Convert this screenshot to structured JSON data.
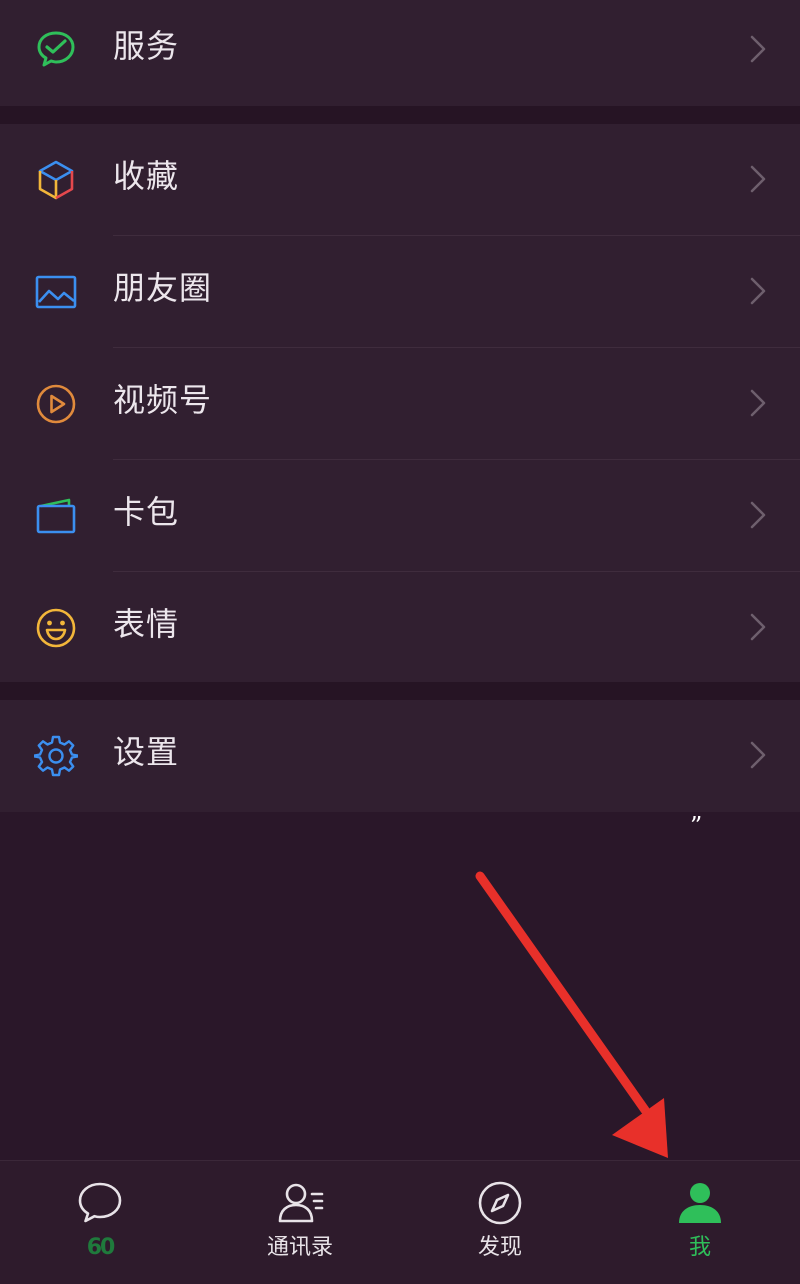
{
  "menu": {
    "services": {
      "label": "服务",
      "icon": "services-check-icon"
    },
    "favorites": {
      "label": "收藏",
      "icon": "favorites-cube-icon"
    },
    "moments": {
      "label": "朋友圈",
      "icon": "moments-image-icon"
    },
    "channels": {
      "label": "视频号",
      "icon": "channels-play-icon"
    },
    "cards": {
      "label": "卡包",
      "icon": "wallet-card-icon"
    },
    "stickers": {
      "label": "表情",
      "icon": "smiley-icon"
    },
    "settings": {
      "label": "设置",
      "icon": "gear-icon"
    }
  },
  "stray_mark": "”",
  "tabbar": {
    "tabs": [
      {
        "label": "60",
        "icon": "chat-bubble-icon",
        "active": false
      },
      {
        "label": "通讯录",
        "icon": "contacts-icon",
        "active": false
      },
      {
        "label": "发现",
        "icon": "compass-icon",
        "active": false
      },
      {
        "label": "我",
        "icon": "person-icon",
        "active": true
      }
    ]
  },
  "colors": {
    "background": "#2a1729",
    "row_background": "#311f30",
    "active_green": "#2fbf5a",
    "annotation_arrow": "#e8302a"
  }
}
